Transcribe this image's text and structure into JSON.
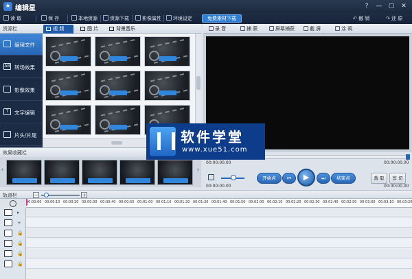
{
  "window": {
    "title": "编辑星",
    "logo_glyph": "★"
  },
  "titlebar_buttons": [
    "?",
    "—",
    "▢",
    "✕"
  ],
  "toolbar": {
    "items": [
      {
        "label": "读 取",
        "icon": "folder-open-icon"
      },
      {
        "label": "保 存",
        "icon": "save-icon"
      },
      {
        "label": "本地资源",
        "icon": "upload-icon"
      },
      {
        "label": "资源下载",
        "icon": "download-icon"
      },
      {
        "label": "影像属性",
        "icon": "image-props-icon"
      },
      {
        "label": "环境设定",
        "icon": "gear-icon"
      }
    ],
    "free_download": "免费素材下载",
    "undo": "撤 销",
    "redo": "还 原"
  },
  "resources": {
    "header": "资源栏",
    "tabs": [
      {
        "label": "视 频",
        "icon": "video-icon",
        "active": true
      },
      {
        "label": "图 片",
        "icon": "camera-icon",
        "active": false
      },
      {
        "label": "背景音乐",
        "icon": "music-icon",
        "active": false
      }
    ],
    "sidebar": [
      {
        "label": "编辑文件",
        "icon": "file-edit-icon",
        "glyph": "",
        "active": true
      },
      {
        "label": "转场效果",
        "icon": "transition-icon",
        "glyph": "AB",
        "active": false
      },
      {
        "label": "影像效果",
        "icon": "effect-icon",
        "glyph": "",
        "active": false
      },
      {
        "label": "文字编辑",
        "icon": "text-icon",
        "glyph": "T",
        "active": false
      },
      {
        "label": "片头/片尾",
        "icon": "intro-outro-icon",
        "glyph": "",
        "active": false
      }
    ],
    "thumbnail_count": 9
  },
  "effects": {
    "header": "效果收藏栏",
    "left_arrow": "‹",
    "right_arrow": "›",
    "thumb_count": 5
  },
  "recorder": {
    "items": [
      {
        "label": "录 音",
        "icon": "microphone-icon"
      },
      {
        "label": "捕 获",
        "icon": "capture-icon"
      },
      {
        "label": "屏幕捕获",
        "icon": "screen-capture-icon"
      },
      {
        "label": "截 屏",
        "icon": "screenshot-icon"
      },
      {
        "label": "涂 鸦",
        "icon": "brush-icon"
      }
    ]
  },
  "player": {
    "time_current": "00:00:00.00",
    "time_total": "00:00:00.00",
    "time_left": "00:00:00.00",
    "time_right": "00:00:00.00",
    "start_point": "开始点",
    "end_point": "结束点",
    "prev_glyph": "⏮",
    "play_glyph": "▶",
    "next_glyph": "⏭",
    "crop": "裁 取",
    "cut": "剪 切"
  },
  "timeline": {
    "header": "轨道栏",
    "ticks": [
      "00:00:00",
      "00:00:10",
      "00:00:20",
      "00:00:30",
      "00:00:40",
      "00:00:50",
      "00:01:00",
      "00:01:10",
      "00:01:20",
      "00:01:30",
      "00:01:40",
      "00:01:50",
      "00:02:00",
      "00:02:10",
      "00:02:20",
      "00:02:30",
      "00:02:40",
      "00:02:50",
      "00:03:00",
      "00:03:10",
      "00:03:20"
    ],
    "tracks": [
      {
        "icon": "video-track-icon",
        "aux": "▸"
      },
      {
        "icon": "audio-track-icon",
        "aux": "+"
      },
      {
        "icon": "transition-track-icon",
        "aux": "🔒"
      },
      {
        "icon": "effect-track-icon",
        "aux": "🔒"
      },
      {
        "icon": "text-track-icon",
        "aux": "🔒"
      },
      {
        "icon": "music-track-icon",
        "aux": "🔒"
      }
    ]
  },
  "watermark": {
    "title": "软件学堂",
    "url": "www.xue51.com"
  }
}
